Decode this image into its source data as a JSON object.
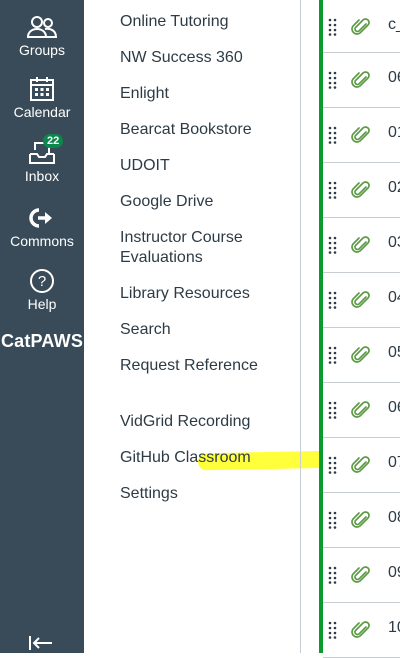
{
  "global_nav": {
    "items": [
      {
        "label": "Groups",
        "icon": "groups-icon"
      },
      {
        "label": "Calendar",
        "icon": "calendar-icon"
      },
      {
        "label": "Inbox",
        "icon": "inbox-icon",
        "badge": "22"
      },
      {
        "label": "Commons",
        "icon": "commons-icon"
      },
      {
        "label": "Help",
        "icon": "help-icon"
      }
    ],
    "brand": "CatPAWS",
    "background": "#394b58",
    "badge_color": "#0b874b"
  },
  "course_menu": {
    "items": [
      "Online Tutoring",
      "NW Success 360",
      "Enlight",
      "Bearcat Bookstore",
      "UDOIT",
      "Google Drive",
      "Instructor Course Evaluations",
      "Library Resources",
      "Search",
      "Request Reference",
      "VidGrid Recording",
      "GitHub Classroom",
      "Settings"
    ],
    "highlighted": "GitHub Classroom",
    "highlight_color": "#ffff3b"
  },
  "modules": {
    "accent": "#0b9b2c",
    "rows": [
      "c_",
      "06",
      "01",
      "02",
      "03",
      "04",
      "05",
      "06",
      "07",
      "08",
      "09",
      "10"
    ]
  }
}
